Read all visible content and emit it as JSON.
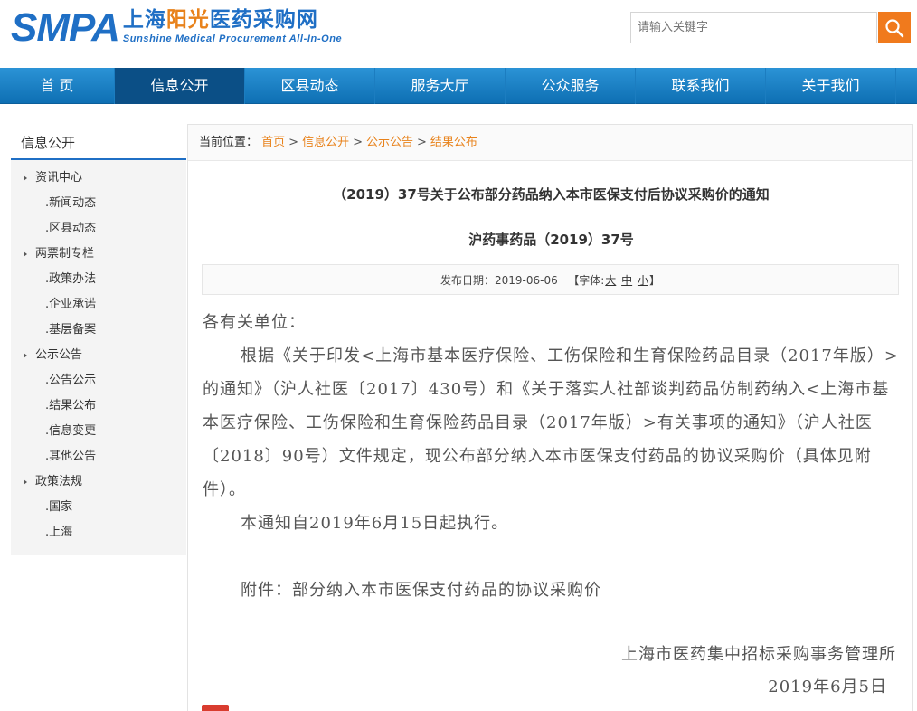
{
  "header": {
    "logo_smpa": "SMPA",
    "logo_cn_1": "上海",
    "logo_cn_2": "阳光",
    "logo_cn_3": "医药采购网",
    "logo_en": "Sunshine Medical Procurement All-In-One",
    "search_placeholder": "请输入关键字",
    "search_icon": "search-icon"
  },
  "nav": {
    "items": [
      "首 页",
      "信息公开",
      "区县动态",
      "服务大厅",
      "公众服务",
      "联系我们",
      "关于我们"
    ],
    "active_index": 1
  },
  "sidebar": {
    "title": "信息公开",
    "groups": [
      {
        "label": "资讯中心",
        "items": [
          ".新闻动态",
          ".区县动态"
        ]
      },
      {
        "label": "两票制专栏",
        "items": [
          ".政策办法",
          ".企业承诺",
          ".基层备案"
        ]
      },
      {
        "label": "公示公告",
        "items": [
          ".公告公示",
          ".结果公布",
          ".信息变更",
          ".其他公告"
        ]
      },
      {
        "label": "政策法规",
        "items": [
          ".国家",
          ".上海"
        ]
      }
    ]
  },
  "breadcrumb": {
    "prefix": "当前位置：",
    "links": [
      "首页",
      "信息公开",
      "公示公告",
      "结果公布"
    ],
    "sep": ">"
  },
  "article": {
    "title": "（2019）37号关于公布部分药品纳入本市医保支付后协议采购价的通知",
    "subtitle": "沪药事药品（2019）37号",
    "meta_date_label": "发布日期：",
    "meta_date": "2019-06-06",
    "meta_font_open": "【字体:",
    "meta_font_large": "大",
    "meta_font_medium": "中",
    "meta_font_small": "小",
    "meta_font_close": "】",
    "salutation": "各有关单位：",
    "para1": "根据《关于印发<上海市基本医疗保险、工伤保险和生育保险药品目录（2017年版）>的通知》（沪人社医〔2017〕430号）和《关于落实人社部谈判药品仿制药纳入<上海市基本医疗保险、工伤保险和生育保险药品目录（2017年版）>有关事项的通知》（沪人社医〔2018〕90号）文件规定，现公布部分纳入本市医保支付药品的协议采购价（具体见附件）。",
    "para2": "本通知自2019年6月15日起执行。",
    "attachment": "附件：部分纳入本市医保支付药品的协议采购价",
    "signature_org": "上海市医药集中招标采购事务管理所",
    "signature_date": "2019年6月5日"
  },
  "colors": {
    "brand_blue": "#1f6fc5",
    "accent_orange": "#e8821b",
    "nav_active": "#0b4f86"
  }
}
